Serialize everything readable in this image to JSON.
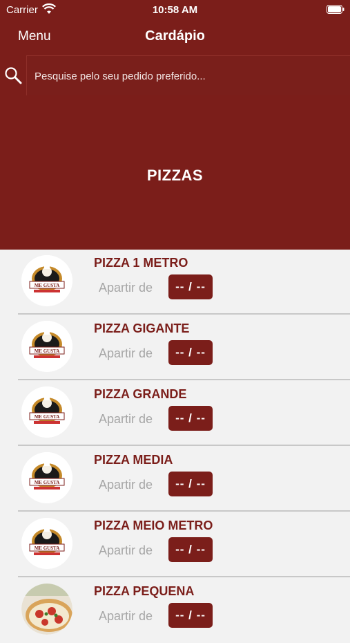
{
  "status_bar": {
    "carrier": "Carrier",
    "time": "10:58 AM"
  },
  "navbar": {
    "menu_label": "Menu",
    "title": "Cardápio"
  },
  "search": {
    "placeholder": "Pesquise pelo seu pedido preferido...",
    "value": ""
  },
  "category": {
    "title": "PIZZAS"
  },
  "items": [
    {
      "name": "PIZZA 1 METRO",
      "from_label": "Apartir de",
      "price": "-- / --",
      "image": "logo"
    },
    {
      "name": "PIZZA GIGANTE",
      "from_label": "Apartir de",
      "price": "-- / --",
      "image": "logo"
    },
    {
      "name": "PIZZA GRANDE",
      "from_label": "Apartir de",
      "price": "-- / --",
      "image": "logo"
    },
    {
      "name": "PIZZA MEDIA",
      "from_label": "Apartir de",
      "price": "-- / --",
      "image": "logo"
    },
    {
      "name": "PIZZA MEIO METRO",
      "from_label": "Apartir de",
      "price": "-- / --",
      "image": "logo"
    },
    {
      "name": "PIZZA PEQUENA",
      "from_label": "Apartir de",
      "price": "-- / --",
      "image": "pizza-photo"
    }
  ],
  "logo_text": "ME GUSTA",
  "colors": {
    "primary": "#7b1e1a",
    "background": "#f2f2f2",
    "muted_text": "#a6a6a6"
  }
}
